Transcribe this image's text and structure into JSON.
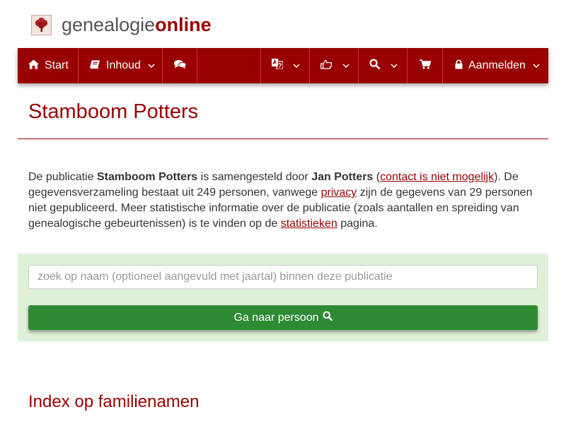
{
  "brand": {
    "name_part1": "genealogie",
    "name_part2": "online"
  },
  "nav": {
    "start_label": "Start",
    "inhoud_label": "Inhoud",
    "login_label": "Aanmelden"
  },
  "page": {
    "title": "Stamboom Potters"
  },
  "intro": {
    "t1": "De publicatie ",
    "pub_name": "Stamboom Potters",
    "t2": " is samengesteld door ",
    "author": "Jan Potters",
    "t3": " (",
    "contact_link": "contact is niet mogelijk",
    "t4": "). De gegevensverzameling bestaat uit 249 personen, vanwege ",
    "privacy_link": "privacy",
    "t5": " zijn de gegevens van 29 personen niet gepubliceerd. Meer statistische informatie over de publicatie (zoals aantallen en spreiding van genealogische gebeurtenissen) is te vinden op de ",
    "stats_link": "statistieken",
    "t6": " pagina."
  },
  "search": {
    "placeholder": "zoek op naam (optioneel aangevuld met jaartal) binnen deze publicatie",
    "value": "",
    "button_label": "Ga naar persoon"
  },
  "section": {
    "index_title": "Index op familienamen"
  },
  "colors": {
    "brand": "#990000",
    "panel": "#dff0d8",
    "button": "#2e8b34"
  },
  "icons": [
    "tree-logo-icon",
    "home-icon",
    "book-icon",
    "chevron-down-icon",
    "comments-icon",
    "translate-icon",
    "thumbs-up-icon",
    "search-icon",
    "cart-icon",
    "lock-icon"
  ]
}
